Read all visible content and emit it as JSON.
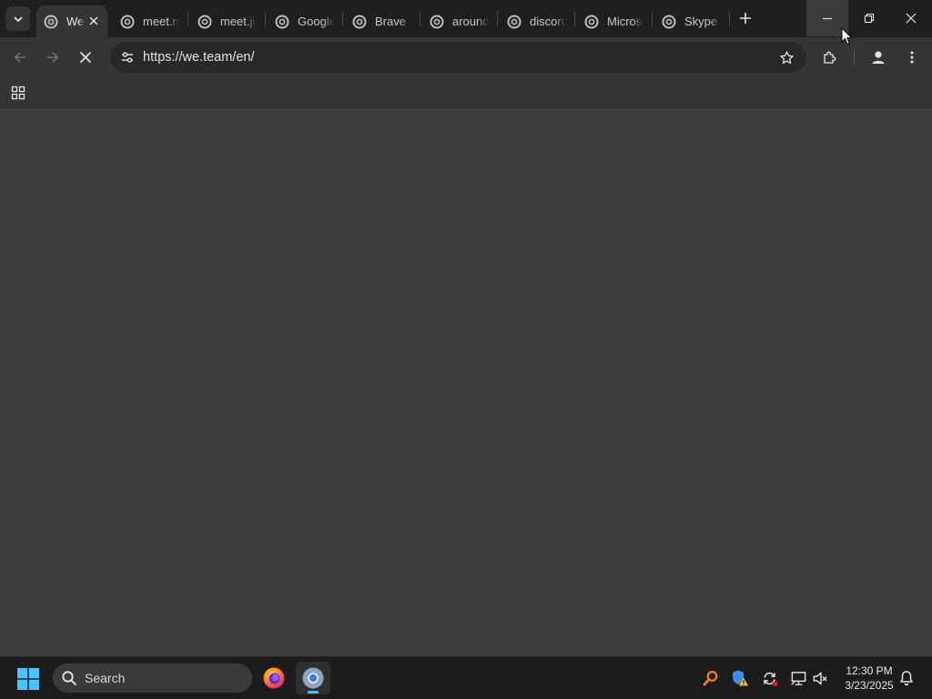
{
  "browser": {
    "tabs": [
      {
        "title": "We",
        "active": true,
        "favicon": "chrome-loading-favicon-icon"
      },
      {
        "title": "meet.n",
        "active": false,
        "favicon": "chrome-favicon-icon"
      },
      {
        "title": "meet.ji",
        "active": false,
        "favicon": "chrome-favicon-icon"
      },
      {
        "title": "Google",
        "active": false,
        "favicon": "chrome-favicon-icon"
      },
      {
        "title": "Brave T",
        "active": false,
        "favicon": "chrome-favicon-icon"
      },
      {
        "title": "around",
        "active": false,
        "favicon": "chrome-favicon-icon"
      },
      {
        "title": "discord",
        "active": false,
        "favicon": "chrome-favicon-icon"
      },
      {
        "title": "Micros",
        "active": false,
        "favicon": "chrome-favicon-icon"
      },
      {
        "title": "Skype",
        "active": false,
        "favicon": "chrome-favicon-icon"
      }
    ],
    "omnibox": {
      "url": "https://we.team/en/"
    },
    "page_loading": true
  },
  "taskbar": {
    "search_label": "Search",
    "clock": {
      "time": "12:30 PM",
      "date": "3/23/2025"
    },
    "pinned_apps": [
      "firefox-icon",
      "chrome-icon"
    ],
    "tray_icons": [
      "search-magnifier-icon",
      "defender-warning-icon",
      "sync-icon",
      "network-icon",
      "volume-muted-icon",
      "notification-bell-icon"
    ]
  },
  "colors": {
    "tab_strip": "#1f1f1f",
    "toolbar": "#353535",
    "content": "#3c3c3c",
    "taskbar": "#1c1c1c",
    "accent": "#4cc2ff"
  }
}
